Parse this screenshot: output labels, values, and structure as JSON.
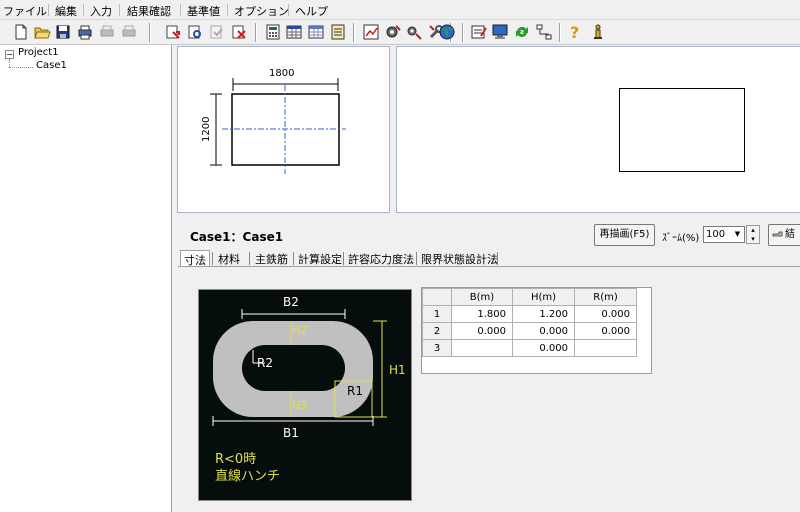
{
  "menu": [
    "ファイル",
    "編集",
    "入力",
    "結果確認",
    "基準値",
    "オプション",
    "ヘルプ"
  ],
  "tree": {
    "project": "Project1",
    "case": "Case1",
    "expander": "−"
  },
  "preview": {
    "width_label": "1800",
    "height_label": "1200"
  },
  "case_header": {
    "title": "Case1：Case1",
    "redraw_label": "再描画(F5)",
    "zoom_label": "ｽﾞｰﾑ(%)",
    "zoom_value": "100",
    "extra_label": "結"
  },
  "tabs": [
    "寸法",
    "材料",
    "主鉄筋",
    "計算設定",
    "許容応力度法",
    "限界状態設計法"
  ],
  "figure": {
    "b2": "B2",
    "b1": "B1",
    "h1": "H1",
    "h2": "H2",
    "h3": "H3",
    "r1": "R1",
    "r2": "R2",
    "note_line1": "R<0時",
    "note_line2": "直線ハンチ"
  },
  "grid": {
    "headers": [
      "B(m)",
      "H(m)",
      "R(m)"
    ],
    "rows": [
      {
        "n": "1",
        "b": "1.800",
        "h": "1.200",
        "r": "0.000"
      },
      {
        "n": "2",
        "b": "0.000",
        "h": "0.000",
        "r": "0.000"
      },
      {
        "n": "3",
        "b": "",
        "h": "0.000",
        "r": ""
      }
    ]
  },
  "colors": {
    "figure_bg": "#050e0c",
    "section_fill": "#c0c0c0",
    "dim_line": "#ffffff",
    "hatch_line": "#e0e04a",
    "axis_line": "#3a5bd0"
  }
}
